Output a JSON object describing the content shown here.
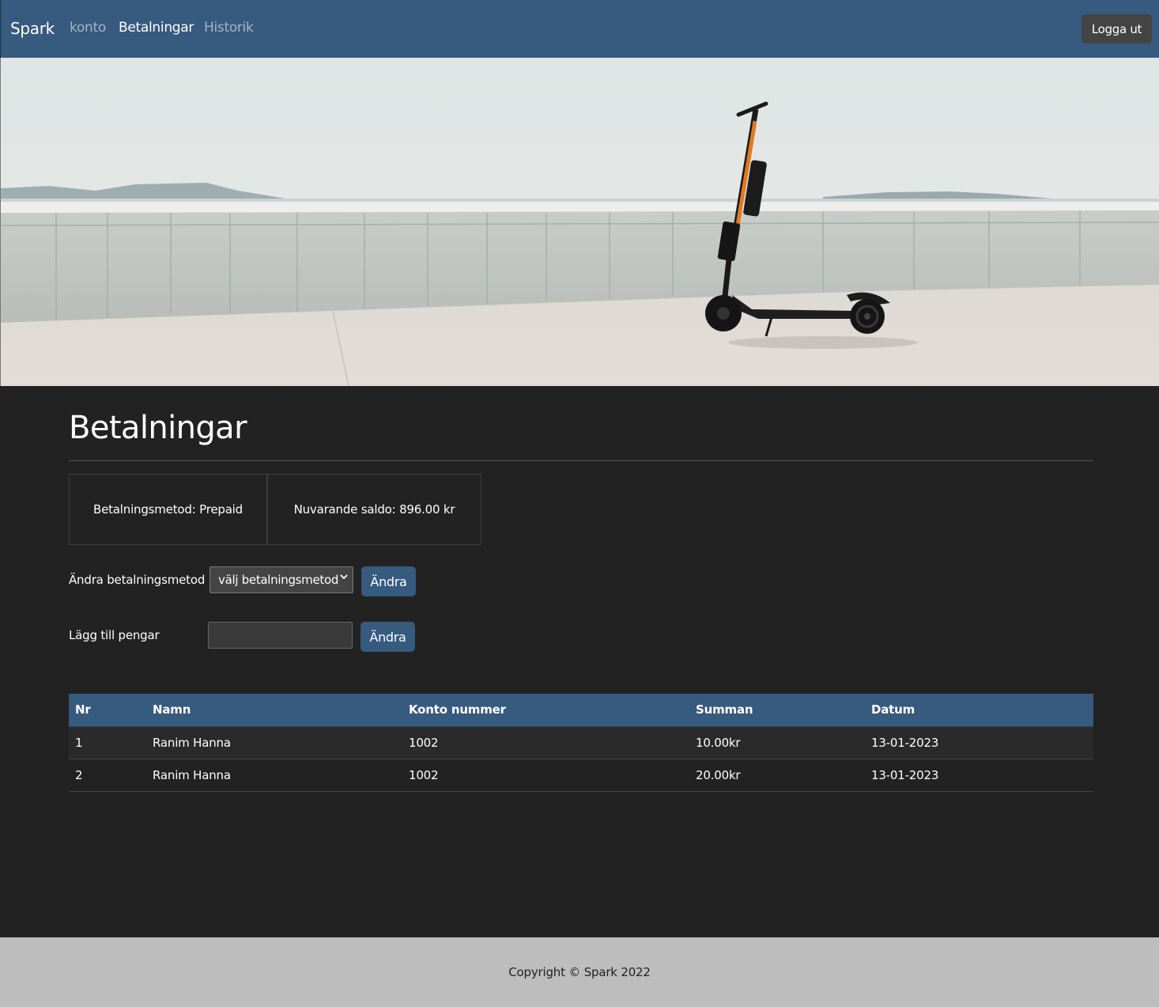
{
  "nav": {
    "brand": "Spark",
    "links": [
      "konto",
      "Betalningar",
      "Historik"
    ],
    "logout": "Logga ut"
  },
  "page": {
    "title": "Betalningar"
  },
  "info": {
    "method": "Betalningsmetod: Prepaid",
    "saldo": "Nuvarande saldo: 896.00 kr"
  },
  "forms": {
    "change_method_label": "Ändra betalningsmetod",
    "method_select_value": "välj betalningsmetod",
    "change_button": "Ändra",
    "add_money_label": "Lägg till pengar",
    "add_money_value": "",
    "add_button": "Ändra"
  },
  "table": {
    "headers": [
      "Nr",
      "Namn",
      "Konto nummer",
      "Summan",
      "Datum"
    ],
    "rows": [
      [
        "1",
        "Ranim Hanna",
        "1002",
        "10.00kr",
        "13-01-2023"
      ],
      [
        "2",
        "Ranim Hanna",
        "1002",
        "20.00kr",
        "13-01-2023"
      ]
    ]
  },
  "footer": {
    "text": "Copyright © Spark 2022"
  },
  "colors": {
    "primary": "#375a7f",
    "background": "#222222",
    "footer": "#bdbdbd"
  },
  "icons": {
    "select_arrow": "chevron-down-icon"
  }
}
